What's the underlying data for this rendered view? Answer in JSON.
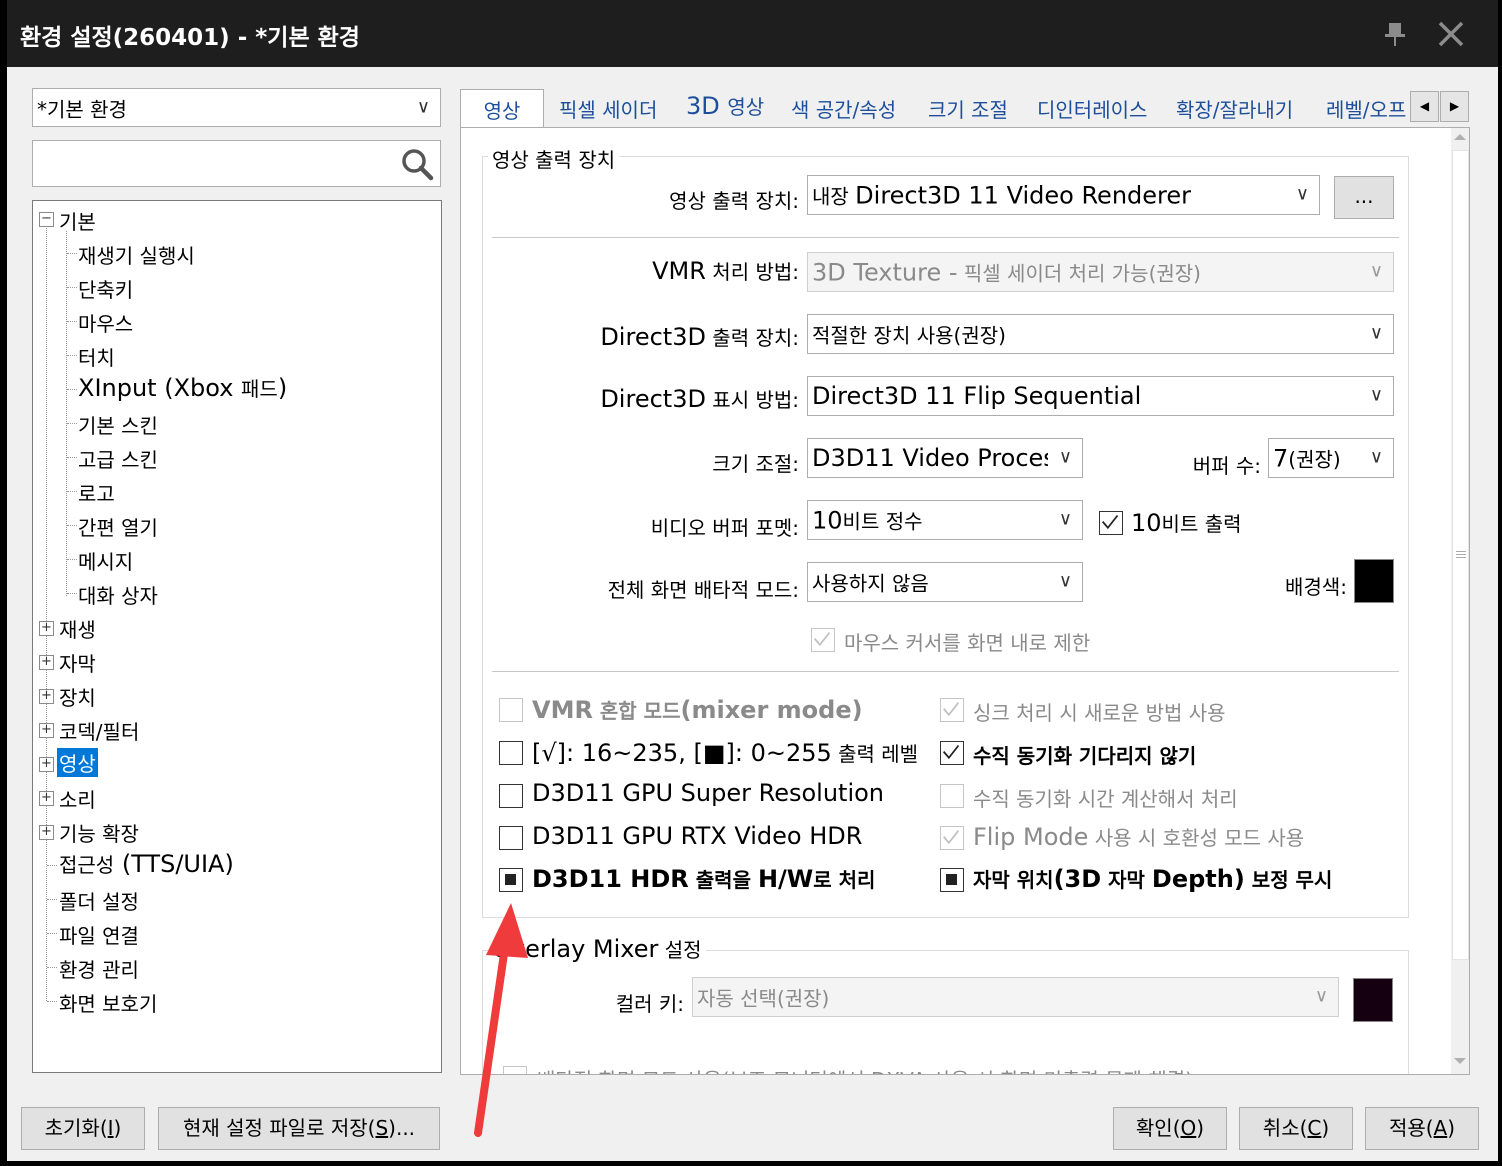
{
  "window": {
    "title": "환경 설정(260401) - *기본 환경"
  },
  "left": {
    "profile": "*기본 환경",
    "search_value": "",
    "tree": {
      "basic": "기본",
      "children": [
        "재생기 실행시",
        "단축키",
        "마우스",
        "터치",
        "XInput (Xbox 패드)",
        "기본 스킨",
        "고급 스킨",
        "로고",
        "간편 열기",
        "메시지",
        "대화 상자"
      ],
      "groups": [
        "재생",
        "자막",
        "장치",
        "코덱/필터",
        "영상",
        "소리",
        "기능 확장"
      ],
      "leaves": [
        "접근성 (TTS/UIA)",
        "폴더 설정",
        "파일 연결",
        "환경 관리",
        "화면 보호기"
      ]
    }
  },
  "tabs": [
    "영상",
    "픽셀 세이더",
    "3D 영상",
    "색 공간/속성",
    "크기 조절",
    "디인터레이스",
    "확장/잘라내기",
    "레벨/오프"
  ],
  "output_group": {
    "title": "영상 출력 장치",
    "device_label": "영상 출력 장치:",
    "device_prefix": "내장",
    "device_value": "Direct3D 11 Video Renderer",
    "more_button": "...",
    "vmr_label_en": "VMR",
    "vmr_label_ko": "처리 방법:",
    "vmr_value_en": "3D Texture -",
    "vmr_value_ko": "픽셀 세이더 처리 가능(권장)",
    "d3d_device_label_en": "Direct3D",
    "d3d_device_label_ko": "출력 장치:",
    "d3d_device_value": "적절한 장치 사용(권장)",
    "d3d_display_label_en": "Direct3D",
    "d3d_display_label_ko": "표시 방법:",
    "d3d_display_value": "Direct3D 11 Flip Sequential",
    "resize_label": "크기 조절:",
    "resize_value": "D3D11 Video Proces",
    "buffer_label": "버퍼 수:",
    "buffer_value_num": "7",
    "buffer_value_ko": "(권장)",
    "vbuf_label": "비디오 버퍼 포멧:",
    "vbuf_value_num": "10",
    "vbuf_value_ko": "비트 정수",
    "bit10_num": "10",
    "bit10_ko": "비트 출력",
    "fullscreen_label": "전체 화면 배타적 모드:",
    "fullscreen_value": "사용하지 않음",
    "bgcolor_label": "배경색:",
    "mouse_limit": "마우스 커서를 화면 내로 제한"
  },
  "options": {
    "vmr_mixer_en1": "VMR",
    "vmr_mixer_ko": "혼합 모드",
    "vmr_mixer_en2": "(mixer mode)",
    "level_en": "[√]: 16~235, [■]: 0~255",
    "level_ko": "출력 레벨",
    "super_res": "D3D11 GPU Super Resolution",
    "rtx_hdr": "D3D11 GPU RTX Video HDR",
    "hdr_hw_en1": "D3D11 HDR",
    "hdr_hw_ko1": "출력을",
    "hdr_hw_en2": "H/W",
    "hdr_hw_ko2": "로 처리",
    "sync_new": "싱크 처리 시 새로운 방법 사용",
    "no_vsync_wait": "수직 동기화 기다리지 않기",
    "vsync_calc": "수직 동기화 시간 계산해서 처리",
    "flip_en": "Flip Mode",
    "flip_ko": "사용 시 호환성 모드 사용",
    "sub_pos_ko1": "자막 위치",
    "sub_pos_en": "(3D",
    "sub_pos_ko2": "자막",
    "sub_pos_en2": "Depth)",
    "sub_pos_ko3": "보정 무시"
  },
  "overlay_group": {
    "title_en": "Overlay Mixer",
    "title_ko": "설정",
    "colorkey_label": "컬러 키:",
    "colorkey_value": "자동 선택(권장)",
    "cut_text": "배타적 화면 모드 사용(보조 모니터에서 DXVA 사용 시 화면 미출력 문제 해결)"
  },
  "footer": {
    "reset": "초기화(",
    "reset_key": "I",
    "save": "현재 설정 파일로 저장(",
    "save_key": "S",
    "save_tail": ")...",
    "ok": "확인(",
    "ok_key": "O",
    "cancel": "취소(",
    "cancel_key": "C",
    "apply": "적용(",
    "apply_key": "A",
    "close_paren": ")"
  },
  "colors": {
    "selection": "#0078d7",
    "titlebar": "#1e1e1e",
    "bg_swatch": "#000000",
    "colorkey_swatch": "#140010",
    "annotation_arrow": "#ef3b3b"
  }
}
